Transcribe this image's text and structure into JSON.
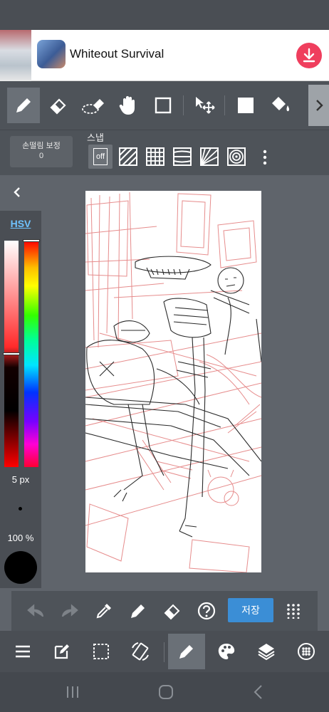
{
  "ad": {
    "title": "Whiteout Survival",
    "thumb_icon": "ad-thumbnail-image",
    "app_icon": "game-app-icon",
    "download_icon": "download-icon",
    "download_color": "#ef3e5d"
  },
  "toolbar": {
    "tools": [
      {
        "name": "pen-tool",
        "icon": "pen-icon",
        "active": true
      },
      {
        "name": "eraser-tool",
        "icon": "eraser-icon"
      },
      {
        "name": "soft-eraser-tool",
        "icon": "soft-eraser-icon"
      },
      {
        "name": "hand-tool",
        "icon": "hand-icon"
      },
      {
        "name": "rectangle-select-tool",
        "icon": "square-outline-icon"
      },
      {
        "name": "move-tool",
        "icon": "move-cursor-icon"
      },
      {
        "name": "fill-color-tool",
        "icon": "filled-square-icon"
      },
      {
        "name": "bucket-tool",
        "icon": "paint-bucket-icon"
      }
    ],
    "scroll_right_icon": "chevron-right-icon"
  },
  "options": {
    "stabilizer_label": "손떨림 보정",
    "stabilizer_value": "0",
    "snap_label": "스냅",
    "snap_off_label": "off",
    "snap_modes": [
      "parallel-snap-icon",
      "grid-snap-icon",
      "perspective-snap-icon",
      "radial-snap-icon",
      "circle-snap-icon"
    ],
    "more_icon": "more-vertical-icon"
  },
  "color_panel": {
    "mode_label": "HSV",
    "brush_size": "5 px",
    "opacity": "100 %",
    "current_color": "#000000",
    "hue_level": 0.0,
    "value_level": 0.5
  },
  "actions": {
    "undo_icon": "undo-icon",
    "redo_icon": "redo-icon",
    "eyedropper_icon": "eyedropper-icon",
    "pen_icon": "pen-icon",
    "eraser_icon": "eraser-icon",
    "help_icon": "help-icon",
    "save_label": "저장",
    "grid_icon": "grid-menu-icon"
  },
  "main_menu": {
    "items": [
      "menu-icon",
      "edit-icon",
      "selection-icon",
      "rotate-icon",
      "brush-icon",
      "palette-icon",
      "layers-icon",
      "materials-icon"
    ]
  },
  "nav": {
    "recents_icon": "recents-icon",
    "home_icon": "home-icon",
    "back_icon": "back-icon"
  }
}
